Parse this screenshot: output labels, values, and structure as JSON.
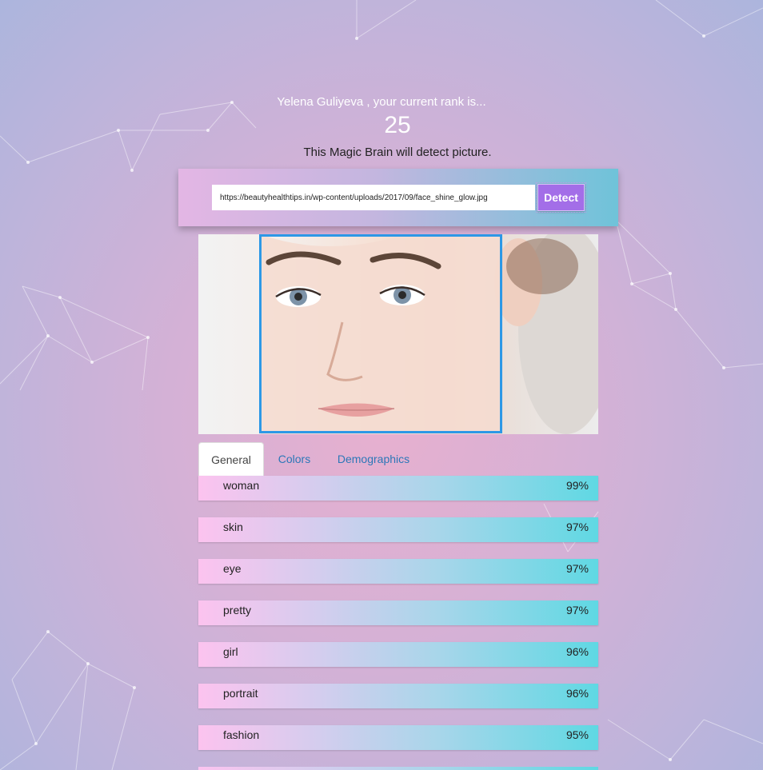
{
  "header": {
    "greeting": "Yelena Guliyeva , your current rank is...",
    "rank": "25",
    "subtitle": "This Magic Brain will detect picture."
  },
  "form": {
    "url_value": "https://beautyhealthtips.in/wp-content/uploads/2017/09/face_shine_glow.jpg",
    "detect_label": "Detect"
  },
  "tabs": [
    {
      "label": "General",
      "active": true
    },
    {
      "label": "Colors",
      "active": false
    },
    {
      "label": "Demographics",
      "active": false
    }
  ],
  "results": [
    {
      "name": "woman",
      "value": "99%"
    },
    {
      "name": "skin",
      "value": "97%"
    },
    {
      "name": "eye",
      "value": "97%"
    },
    {
      "name": "pretty",
      "value": "97%"
    },
    {
      "name": "girl",
      "value": "96%"
    },
    {
      "name": "portrait",
      "value": "96%"
    },
    {
      "name": "fashion",
      "value": "95%"
    }
  ],
  "colors": {
    "detect_button": "#a36ee8",
    "face_box": "#2d98e6",
    "tab_link": "#2c77b8"
  }
}
